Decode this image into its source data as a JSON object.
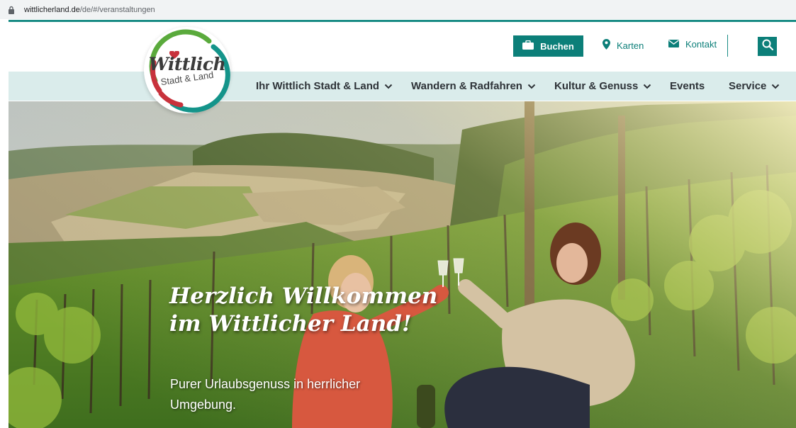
{
  "browser": {
    "url_domain": "wittlicherland.de",
    "url_path": "/de/#/veranstaltungen"
  },
  "logo": {
    "title": "Wittlich",
    "subtitle": "Stadt & Land"
  },
  "utility": {
    "buchen_label": "Buchen",
    "karten_label": "Karten",
    "kontakt_label": "Kontakt"
  },
  "nav": {
    "items": [
      {
        "label": "Ihr Wittlich Stadt & Land",
        "dropdown": true
      },
      {
        "label": "Wandern & Radfahren",
        "dropdown": true
      },
      {
        "label": "Kultur & Genuss",
        "dropdown": true
      },
      {
        "label": "Events",
        "dropdown": false
      },
      {
        "label": "Service",
        "dropdown": true
      }
    ]
  },
  "hero": {
    "title": "Herzlich Willkommen im Wittlicher Land!",
    "subtitle": "Purer Urlaubsgenuss in herrlicher Umgebung."
  },
  "colors": {
    "brand_teal": "#0c7f79",
    "nav_bg": "#daeceb",
    "logo_red": "#c8323c",
    "logo_green": "#5aaa3c"
  },
  "icons": [
    "lock-icon",
    "briefcase-icon",
    "map-pin-icon",
    "envelope-icon",
    "search-icon",
    "chevron-down-icon",
    "heart-icon"
  ]
}
